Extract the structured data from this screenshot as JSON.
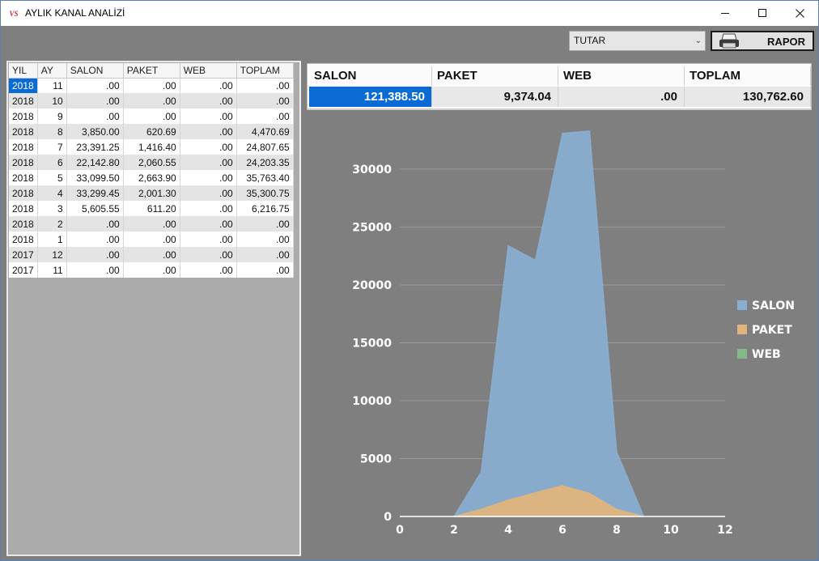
{
  "window": {
    "icon_text": "VS",
    "title": "AYLIK KANAL ANALİZİ",
    "minimize_icon": "minimize-icon",
    "maximize_icon": "maximize-icon",
    "close_icon": "close-icon"
  },
  "toolbar": {
    "measure_select_value": "TUTAR",
    "report_button_label": "RAPOR",
    "report_icon": "printer-icon"
  },
  "monthly_grid": {
    "columns": [
      "YIL",
      "AY",
      "SALON",
      "PAKET",
      "WEB",
      "TOPLAM"
    ],
    "rows": [
      [
        "2018",
        "11",
        ".00",
        ".00",
        ".00",
        ".00"
      ],
      [
        "2018",
        "10",
        ".00",
        ".00",
        ".00",
        ".00"
      ],
      [
        "2018",
        "9",
        ".00",
        ".00",
        ".00",
        ".00"
      ],
      [
        "2018",
        "8",
        "3,850.00",
        "620.69",
        ".00",
        "4,470.69"
      ],
      [
        "2018",
        "7",
        "23,391.25",
        "1,416.40",
        ".00",
        "24,807.65"
      ],
      [
        "2018",
        "6",
        "22,142.80",
        "2,060.55",
        ".00",
        "24,203.35"
      ],
      [
        "2018",
        "5",
        "33,099.50",
        "2,663.90",
        ".00",
        "35,763.40"
      ],
      [
        "2018",
        "4",
        "33,299.45",
        "2,001.30",
        ".00",
        "35,300.75"
      ],
      [
        "2018",
        "3",
        "5,605.55",
        "611.20",
        ".00",
        "6,216.75"
      ],
      [
        "2018",
        "2",
        ".00",
        ".00",
        ".00",
        ".00"
      ],
      [
        "2018",
        "1",
        ".00",
        ".00",
        ".00",
        ".00"
      ],
      [
        "2017",
        "12",
        ".00",
        ".00",
        ".00",
        ".00"
      ],
      [
        "2017",
        "11",
        ".00",
        ".00",
        ".00",
        ".00"
      ]
    ]
  },
  "totals": {
    "headers": [
      "SALON",
      "PAKET",
      "WEB",
      "TOPLAM"
    ],
    "values": [
      "121,388.50",
      "9,374.04",
      ".00",
      "130,762.60"
    ]
  },
  "colors": {
    "selection": "#0a6bd4",
    "salon": "#8aaed0",
    "paket": "#e0b47c",
    "web": "#86b88a"
  },
  "chart_data": {
    "type": "area",
    "x_ticks": [
      0,
      2,
      4,
      6,
      8,
      10,
      12
    ],
    "y_ticks": [
      0,
      5000,
      10000,
      15000,
      20000,
      25000,
      30000
    ],
    "xlim": [
      0,
      12
    ],
    "ylim": [
      0,
      33000
    ],
    "grid": "horizontal",
    "legend_position": "right",
    "series": [
      {
        "name": "SALON",
        "color": "#8aaed0",
        "points": [
          [
            2,
            0
          ],
          [
            3,
            3850
          ],
          [
            4,
            23391.25
          ],
          [
            5,
            22142.8
          ],
          [
            6,
            33099.5
          ],
          [
            7,
            33299.45
          ],
          [
            8,
            5605.55
          ],
          [
            9,
            0
          ]
        ]
      },
      {
        "name": "PAKET",
        "color": "#e0b47c",
        "points": [
          [
            2,
            0
          ],
          [
            3,
            620.69
          ],
          [
            4,
            1416.4
          ],
          [
            5,
            2060.55
          ],
          [
            6,
            2663.9
          ],
          [
            7,
            2001.3
          ],
          [
            8,
            611.2
          ],
          [
            9,
            0
          ]
        ]
      },
      {
        "name": "WEB",
        "color": "#86b88a",
        "points": [
          [
            2,
            0
          ],
          [
            3,
            0
          ],
          [
            4,
            0
          ],
          [
            5,
            0
          ],
          [
            6,
            0
          ],
          [
            7,
            0
          ],
          [
            8,
            0
          ],
          [
            9,
            0
          ]
        ]
      }
    ]
  }
}
